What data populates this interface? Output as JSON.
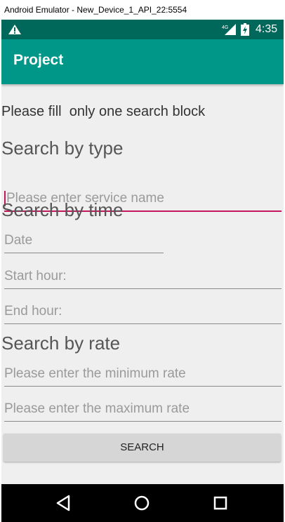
{
  "window": {
    "title": "Android Emulator - New_Device_1_API_22:5554"
  },
  "status_bar": {
    "network": "4G",
    "time": "4:35",
    "warning_icon": "warning-icon",
    "signal_icon": "signal-icon",
    "battery_icon": "battery-icon"
  },
  "app_bar": {
    "title": "Project",
    "color": "#009688"
  },
  "form": {
    "instruction": "Please fill  only one search block",
    "type_section": {
      "heading": "Search by type",
      "service_placeholder": "Please enter service name"
    },
    "time_section": {
      "heading": "Search by time",
      "date_placeholder": "Date",
      "start_placeholder": "Start hour:",
      "end_placeholder": "End hour:"
    },
    "rate_section": {
      "heading": "Search by rate",
      "min_placeholder": "Please enter the minimum rate",
      "max_placeholder": "Please enter the maximum rate"
    },
    "search_button": "SEARCH"
  },
  "nav_bar": {
    "back_icon": "back-icon",
    "home_icon": "home-icon",
    "recents_icon": "recents-icon"
  },
  "colors": {
    "accent": "#c2185b",
    "status_bar": "#00675b"
  }
}
